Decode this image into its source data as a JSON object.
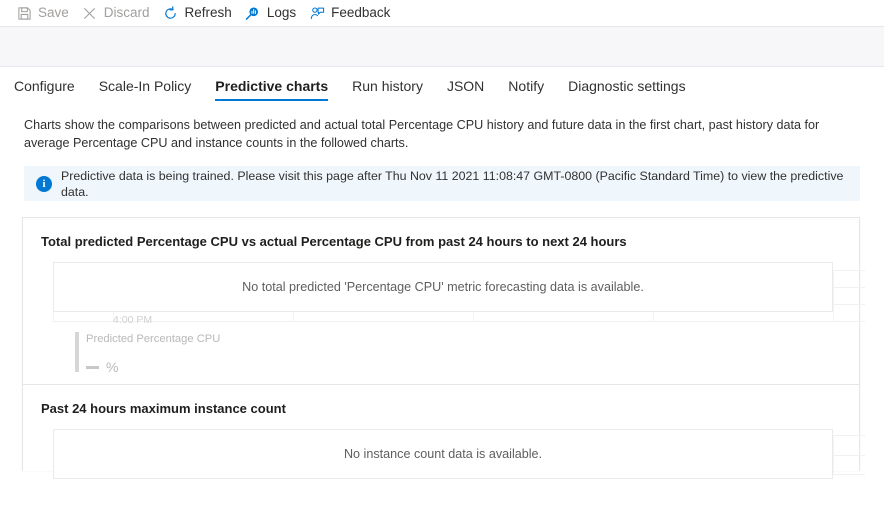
{
  "commandbar": {
    "items": [
      {
        "label": "Save",
        "icon": "save-icon",
        "enabled": false
      },
      {
        "label": "Discard",
        "icon": "discard-icon",
        "enabled": false
      },
      {
        "label": "Refresh",
        "icon": "refresh-icon",
        "enabled": true
      },
      {
        "label": "Logs",
        "icon": "logs-icon",
        "enabled": true
      },
      {
        "label": "Feedback",
        "icon": "feedback-icon",
        "enabled": true
      }
    ]
  },
  "tabs": [
    {
      "label": "Configure",
      "active": false
    },
    {
      "label": "Scale-In Policy",
      "active": false
    },
    {
      "label": "Predictive charts",
      "active": true
    },
    {
      "label": "Run history",
      "active": false
    },
    {
      "label": "JSON",
      "active": false
    },
    {
      "label": "Notify",
      "active": false
    },
    {
      "label": "Diagnostic settings",
      "active": false
    }
  ],
  "description": "Charts show the comparisons between predicted and actual total Percentage CPU history and future data in the first chart, past history data for average Percentage CPU and instance counts in the followed charts.",
  "banner": {
    "icon": "info-icon",
    "glyph": "i",
    "text": "Predictive data is being trained. Please visit this page after Thu Nov 11 2021 11:08:47 GMT-0800 (Pacific Standard Time) to view the predictive data.",
    "background": "#eff6fc",
    "accent": "#0078d4"
  },
  "cards": [
    {
      "title": "Total predicted Percentage CPU vs actual Percentage CPU from past 24 hours to next 24 hours",
      "empty_text": "No total predicted 'Percentage CPU' metric forecasting data is available.",
      "axis_tick": "4:00 PM",
      "legend": {
        "name": "Predicted Percentage CPU",
        "value": "",
        "unit": "%"
      }
    },
    {
      "title": "Past 24 hours maximum instance count",
      "empty_text": "No instance count data is available."
    }
  ],
  "colors": {
    "accent": "#0078d4",
    "text": "#323130",
    "muted": "#605e5c",
    "disabled": "#a19f9d",
    "band": "#f7f7f9",
    "card_border": "#e6e6e6"
  }
}
